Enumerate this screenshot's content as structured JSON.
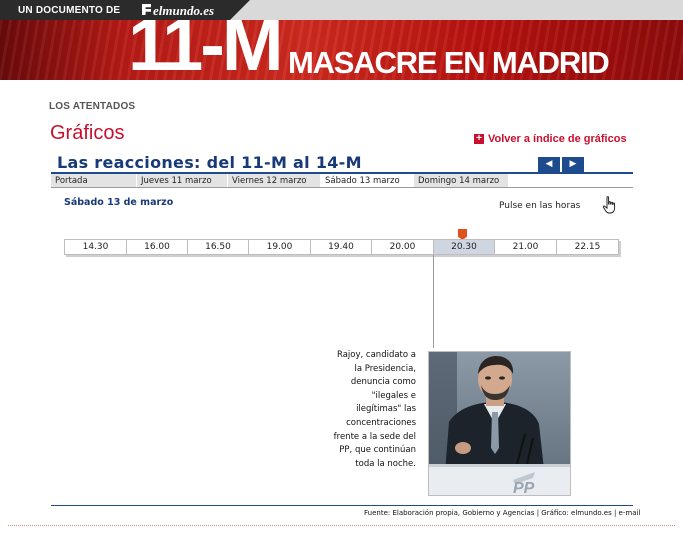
{
  "header": {
    "doc_label": "UN DOCUMENTO DE",
    "brand": "elmundo.es"
  },
  "banner": {
    "big_title": "11-M",
    "subtitle": "MASACRE EN MADRID"
  },
  "section": {
    "label": "LOS ATENTADOS",
    "heading": "Gráficos",
    "back_link": "Volver a índice de gráficos"
  },
  "graphic": {
    "title": "Las reacciones: del 11-M al 14-M",
    "tabs": [
      {
        "label": "Portada",
        "active": false
      },
      {
        "label": "Jueves 11 marzo",
        "active": false
      },
      {
        "label": "Viernes 12 marzo",
        "active": false
      },
      {
        "label": "Sábado 13 marzo",
        "active": true
      },
      {
        "label": "Domingo 14 marzo",
        "active": false
      }
    ],
    "day_label": "Sábado 13 de marzo",
    "hint": "Pulse en las horas",
    "hours": [
      "14.30",
      "16.00",
      "16.50",
      "19.00",
      "19.40",
      "20.00",
      "20.30",
      "21.00",
      "22.15"
    ],
    "active_hour": "20.30",
    "caption": "Rajoy, candidato a la Presidencia, denuncia como \"ilegales e ilegítimas\" las concentraciones frente a la sede del PP, que continúan toda la noche.",
    "photo_logo": "PP",
    "source": "Fuente: Elaboración propia, Gobierno y Agencias | Gráfico: elmundo.es | e-mail"
  },
  "colors": {
    "accent_red": "#c8102e",
    "navy": "#183a78",
    "button_blue": "#1e4a8e",
    "marker_orange": "#e0501b"
  },
  "icons": {
    "back_link": "plus-square-icon",
    "prev": "arrow-left-icon",
    "next": "arrow-right-icon",
    "hand": "pointer-hand-icon",
    "marker": "timeline-marker-icon"
  }
}
